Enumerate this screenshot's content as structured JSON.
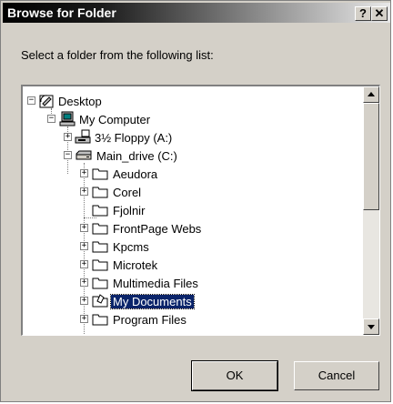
{
  "window": {
    "title": "Browse for Folder",
    "help_label": "?",
    "close_label": "✕"
  },
  "instruction": "Select a folder from the following list:",
  "tree": [
    {
      "label": "Desktop",
      "icon": "desktop-icon",
      "expander": "−"
    },
    {
      "label": "My Computer",
      "icon": "computer-icon",
      "expander": "−"
    },
    {
      "label": "3½ Floppy (A:)",
      "icon": "floppy-drive-icon",
      "expander": "+"
    },
    {
      "label": "Main_drive (C:)",
      "icon": "hard-drive-icon",
      "expander": "−"
    },
    {
      "label": "Aeudora",
      "icon": "folder-icon",
      "expander": "+"
    },
    {
      "label": "Corel",
      "icon": "folder-icon",
      "expander": "+"
    },
    {
      "label": "Fjolnir",
      "icon": "folder-icon",
      "expander": ""
    },
    {
      "label": "FrontPage Webs",
      "icon": "folder-icon",
      "expander": "+"
    },
    {
      "label": "Kpcms",
      "icon": "folder-icon",
      "expander": "+"
    },
    {
      "label": "Microtek",
      "icon": "folder-icon",
      "expander": "+"
    },
    {
      "label": "Multimedia Files",
      "icon": "folder-icon",
      "expander": "+"
    },
    {
      "label": "My Documents",
      "icon": "my-documents-folder-icon",
      "expander": "+",
      "selected": true
    },
    {
      "label": "Program Files",
      "icon": "folder-icon",
      "expander": "+"
    }
  ],
  "buttons": {
    "ok": "OK",
    "cancel": "Cancel"
  }
}
